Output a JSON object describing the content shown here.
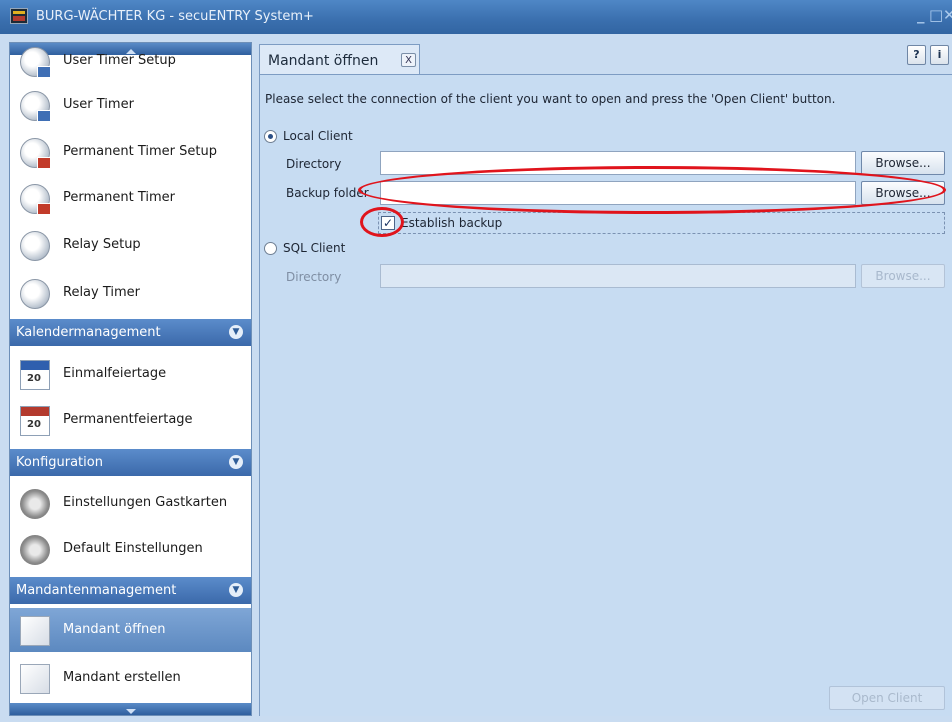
{
  "window": {
    "title": "BURG-WÄCHTER KG - secuENTRY System+",
    "minimize_glyph": "_",
    "maximize_glyph": "□",
    "close_glyph": "✕"
  },
  "sidebar": {
    "timer_items": [
      {
        "label": "User Timer Setup",
        "icon": "user-timer-setup-icon"
      },
      {
        "label": "User Timer",
        "icon": "user-timer-icon"
      },
      {
        "label": "Permanent Timer Setup",
        "icon": "permanent-timer-setup-icon"
      },
      {
        "label": "Permanent Timer",
        "icon": "permanent-timer-icon"
      },
      {
        "label": "Relay Setup",
        "icon": "relay-setup-icon"
      },
      {
        "label": "Relay Timer",
        "icon": "relay-timer-icon"
      }
    ],
    "sections": {
      "calendar": {
        "title": "Kalendermanagement",
        "items": [
          {
            "label": "Einmalfeiertage",
            "icon": "calendar-icon"
          },
          {
            "label": "Permanentfeiertage",
            "icon": "calendar-red-icon"
          }
        ]
      },
      "config": {
        "title": "Konfiguration",
        "items": [
          {
            "label": "Einstellungen Gastkarten",
            "icon": "guest-card-settings-icon"
          },
          {
            "label": "Default Einstellungen",
            "icon": "gear-icon"
          }
        ]
      },
      "client": {
        "title": "Mandantenmanagement",
        "items": [
          {
            "label": "Mandant öffnen",
            "icon": "document-icon",
            "active": true
          },
          {
            "label": "Mandant erstellen",
            "icon": "document-gear-icon"
          }
        ]
      }
    }
  },
  "tab": {
    "label": "Mandant öffnen",
    "close_label": "X"
  },
  "toolbar": {
    "help_label": "?",
    "info_label": "i"
  },
  "form": {
    "instructions": "Please select the connection of the client you want to open and press the 'Open Client' button.",
    "local_client": {
      "label": "Local Client",
      "selected": true,
      "directory_label": "Directory",
      "directory_value": "",
      "browse_label": "Browse...",
      "backup_label": "Backup folder",
      "backup_value": "",
      "backup_browse_label": "Browse...",
      "establish_backup_label": "Establish backup",
      "establish_backup_checked": true
    },
    "sql_client": {
      "label": "SQL Client",
      "selected": false,
      "directory_label": "Directory",
      "directory_value": "",
      "browse_label": "Browse..."
    },
    "open_client_label": "Open Client"
  },
  "colors": {
    "annotation": "#e0141c",
    "accent": "#3b69aa",
    "background": "#c7dcf2"
  }
}
